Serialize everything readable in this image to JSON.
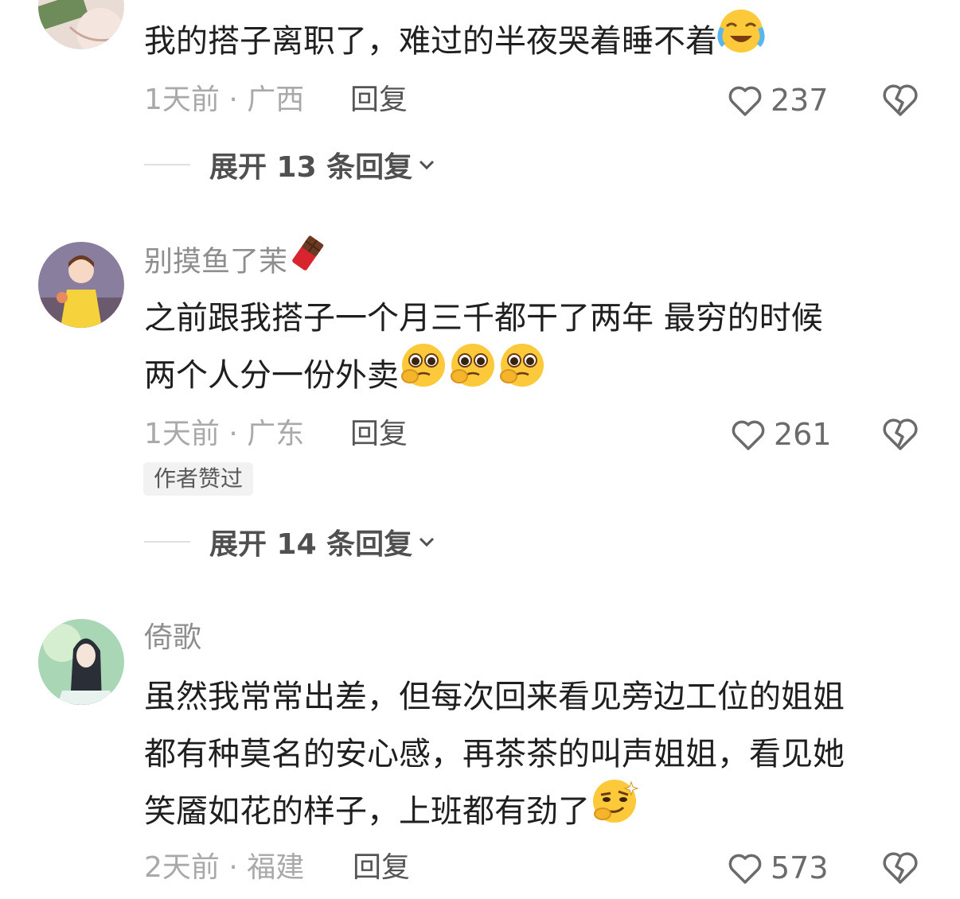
{
  "comments": [
    {
      "username": "",
      "text": "我的搭子离职了，难过的半夜哭着睡不着",
      "emoji_end": [
        "crying-laugh-emoji"
      ],
      "time": "1天前",
      "location": "广西",
      "reply_label": "回复",
      "likes": "237",
      "expand_label": "展开 13 条回复"
    },
    {
      "username": "别摸鱼了茉",
      "username_emoji": "chocolate-bar-emoji",
      "text_line1": "之前跟我搭子一个月三千都干了两年 最穷的时候",
      "text_line2": "两个人分一份外卖",
      "emoji_end": [
        "pleading-face-emoji",
        "pleading-face-emoji",
        "pleading-face-emoji"
      ],
      "time": "1天前",
      "location": "广东",
      "reply_label": "回复",
      "likes": "261",
      "badge": "作者赞过",
      "expand_label": "展开 14 条回复"
    },
    {
      "username": "倚歌",
      "text_line1": "虽然我常常出差，但每次回来看见旁边工位的姐姐",
      "text_line2": "都有种莫名的安心感，再茶茶的叫声姐姐，看见她",
      "text_line3": "笑靥如花的样子，上班都有劲了",
      "emoji_end": [
        "smirk-thinking-emoji"
      ],
      "time": "2天前",
      "location": "福建",
      "reply_label": "回复",
      "likes": "573"
    }
  ],
  "separator": "·",
  "colors": {
    "meta": "#a9a9a9",
    "username": "#8e8e8e",
    "badge_bg": "#f2f2f2",
    "emoji_yellow": "#fcc93b"
  }
}
